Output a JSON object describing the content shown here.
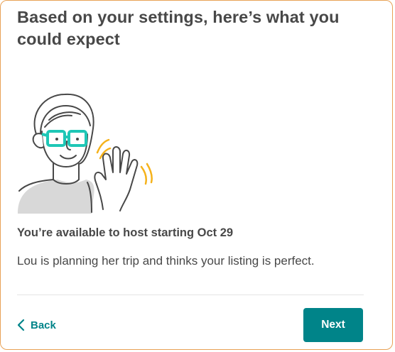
{
  "card": {
    "title": "Based on your settings, here’s what you could expect",
    "subtitle": "You’re available to host starting Oct 29",
    "body": "Lou is planning her trip and thinks your listing is perfect."
  },
  "illustration": {
    "icon": "waving-person-illustration",
    "colors": {
      "glasses": "#1ec7b6",
      "wave_marks": "#f5b21b",
      "shirt": "#d8d8d8",
      "line": "#484848"
    }
  },
  "footer": {
    "back_label": "Back",
    "back_icon": "chevron-left-icon",
    "next_label": "Next"
  },
  "colors": {
    "accent": "#008489",
    "card_border": "#e8a256",
    "text": "#484848"
  }
}
